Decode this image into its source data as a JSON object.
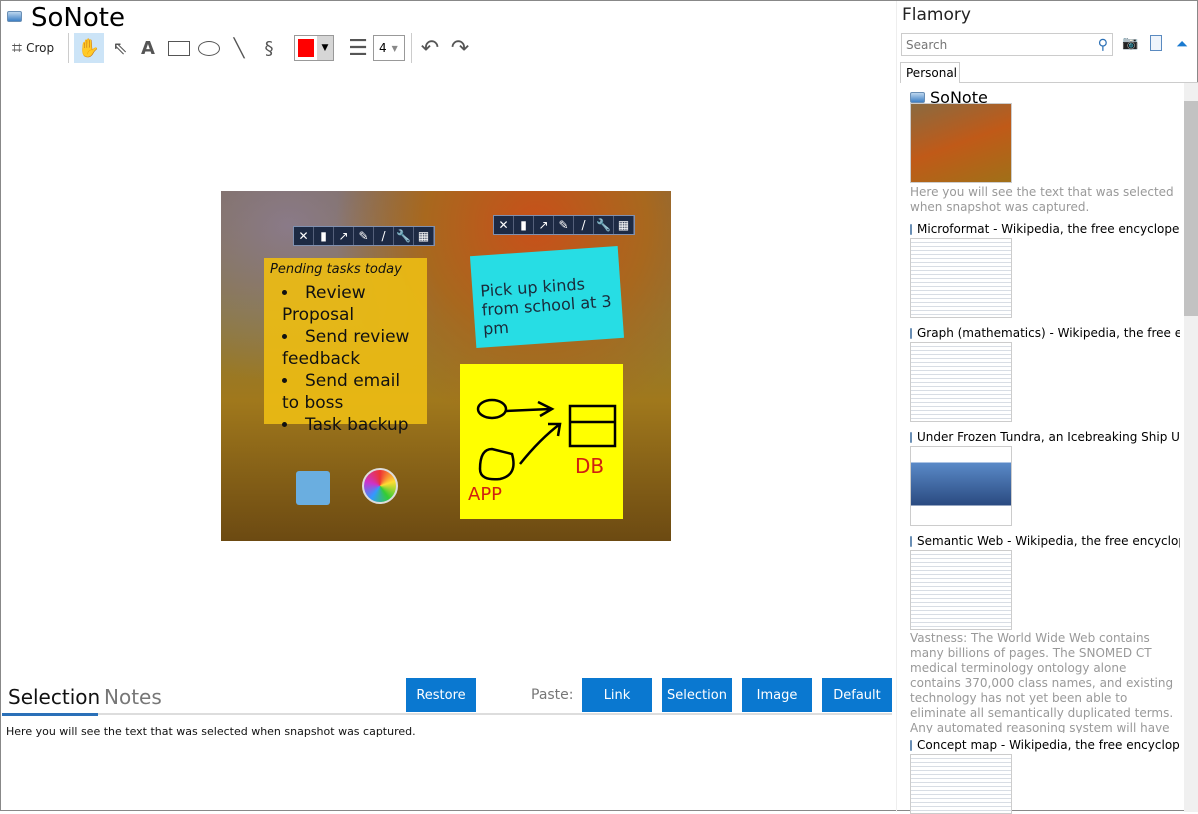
{
  "app": {
    "title": "SoNote"
  },
  "toolbar": {
    "crop_label": "Crop",
    "color": "#ff0000",
    "line_width": "4"
  },
  "canvas": {
    "note1": {
      "title": "Pending tasks today",
      "items": [
        "Review Proposal",
        "Send review feedback",
        "Send email to boss",
        "Task backup"
      ]
    },
    "note2": {
      "text": "Pick up kinds from school at 3 pm"
    },
    "note3": {
      "labels": [
        "DB",
        "APP"
      ]
    }
  },
  "bottom": {
    "tabs": [
      "Selection",
      "Notes"
    ],
    "restore_label": "Restore",
    "paste_label": "Paste:",
    "paste_buttons": [
      "Link",
      "Selection",
      "Image",
      "Default"
    ],
    "selection_text": "Here you will see the text that was selected when snapshot was captured."
  },
  "sidebar": {
    "title": "Flamory",
    "search_placeholder": "Search",
    "tab": "Personal",
    "items": [
      {
        "title": "SoNote",
        "desc": "Here you will see the text that was selected when snapshot was captured."
      },
      {
        "title": "Microformat - Wikipedia, the free encyclopedia"
      },
      {
        "title": "Graph (mathematics) - Wikipedia, the free encyclopedia"
      },
      {
        "title": "Under Frozen Tundra, an Icebreaking Ship Uncovers"
      },
      {
        "title": "Semantic Web - Wikipedia, the free encyclopedia",
        "desc": "Vastness: The World Wide Web contains many billions of pages. The SNOMED CT medical terminology ontology alone contains 370,000 class names, and existing technology has not yet been able to eliminate all semantically duplicated terms. Any automated reasoning system will have to deal with truly huge inputs."
      },
      {
        "title": "Concept map - Wikipedia, the free encyclopedia"
      }
    ]
  }
}
